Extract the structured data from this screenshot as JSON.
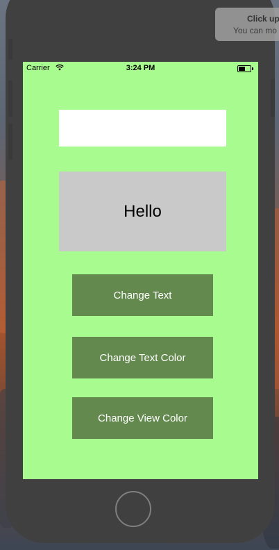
{
  "status_bar": {
    "carrier": "Carrier",
    "time": "3:24 PM"
  },
  "text_field": {
    "value": "",
    "placeholder": ""
  },
  "label": {
    "text": "Hello"
  },
  "buttons": {
    "change_text": "Change Text",
    "change_text_color": "Change Text Color",
    "change_view_color": "Change View Color"
  },
  "notification": {
    "title": "Click up",
    "body": "You can mo"
  },
  "colors": {
    "screen_background": "#a8fb8f",
    "button_background": "#63894f",
    "button_text": "#ffffff",
    "label_background": "#c9c9c9",
    "phone_body": "#404040"
  },
  "icons": [
    "wifi-icon",
    "battery-icon"
  ]
}
